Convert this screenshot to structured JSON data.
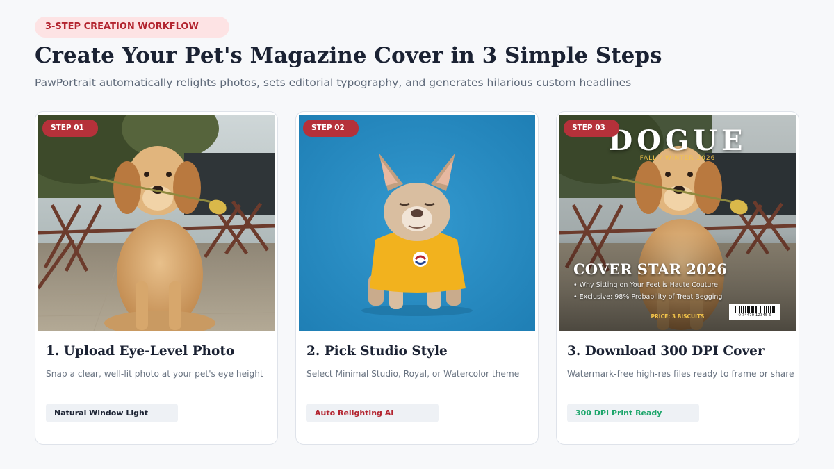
{
  "header": {
    "eyebrow": "3-STEP CREATION WORKFLOW",
    "title": "Create Your Pet's Magazine Cover in 3 Simple Steps",
    "subtitle": "PawPortrait automatically relights photos, sets editorial typography, and generates hilarious custom headlines"
  },
  "steps": [
    {
      "badge": "STEP 01",
      "title": "1. Upload Eye-Level Photo",
      "description": "Snap a clear, well-lit photo at your pet's eye height",
      "tag": "Natural Window Light",
      "tag_color": "#1c2333",
      "image": "golden-retriever-puppy-with-flower"
    },
    {
      "badge": "STEP 02",
      "title": "2. Pick Studio Style",
      "description": "Select Minimal Studio, Royal, or Watercolor theme",
      "tag": "Auto Relighting AI",
      "tag_color": "#b3242f",
      "image": "french-bulldog-yellow-shirt-blue-backdrop"
    },
    {
      "badge": "STEP 03",
      "title": "3. Download 300 DPI Cover",
      "description": "Watermark-free high-res files ready to frame or share",
      "tag": "300 DPI Print Ready",
      "tag_color": "#1ba56a",
      "image": "magazine-cover-golden-retriever"
    }
  ],
  "cover": {
    "masthead": "DOGUE",
    "issue": "FALL / WINTER 2026",
    "cover_line": "COVER STAR 2026",
    "bullets": [
      "• Why Sitting on Your Feet is Haute Couture",
      "• Exclusive: 98% Probability of Treat Begging"
    ],
    "price": "PRICE: 3 BISCUITS",
    "barcode_number": "0 74470 12345 6"
  },
  "colors": {
    "accent": "#b5313a",
    "eyebrow_bg": "#fde3e4",
    "title": "#1b2233",
    "muted": "#6a7482",
    "cover_gold": "#f3c44a"
  }
}
